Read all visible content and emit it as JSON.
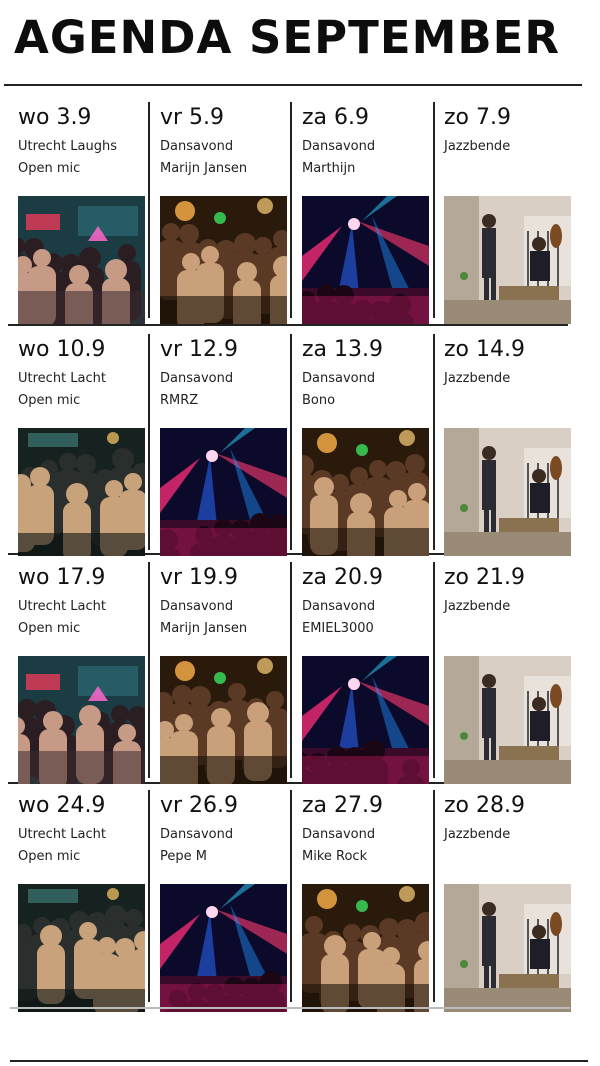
{
  "header": {
    "title": "AGENDA SEPTEMBER"
  },
  "weeks": [
    [
      {
        "day": "wo 3.9",
        "line1": "Utrecht Laughs",
        "line2": "Open mic",
        "photo": "comedy-audience"
      },
      {
        "day": "vr 5.9",
        "line1": "Dansavond",
        "line2": "Marijn Jansen",
        "photo": "dance-crowd"
      },
      {
        "day": "za 6.9",
        "line1": "Dansavond",
        "line2": "Marthijn",
        "photo": "club-lights"
      },
      {
        "day": "zo 7.9",
        "line1": "Jazzbende",
        "line2": "",
        "photo": "jazz-band"
      }
    ],
    [
      {
        "day": "wo 10.9",
        "line1": "Utrecht Lacht",
        "line2": "Open mic",
        "photo": "comedy-crowd"
      },
      {
        "day": "vr 12.9",
        "line1": "Dansavond",
        "line2": "RMRZ",
        "photo": "club-lights"
      },
      {
        "day": "za 13.9",
        "line1": "Dansavond",
        "line2": "Bono",
        "photo": "dance-crowd"
      },
      {
        "day": "zo 14.9",
        "line1": "Jazzbende",
        "line2": "",
        "photo": "jazz-band"
      }
    ],
    [
      {
        "day": "wo 17.9",
        "line1": "Utrecht Lacht",
        "line2": "Open mic",
        "photo": "comedy-audience"
      },
      {
        "day": "vr 19.9",
        "line1": "Dansavond",
        "line2": "Marijn Jansen",
        "photo": "dance-crowd"
      },
      {
        "day": "za 20.9",
        "line1": "Dansavond",
        "line2": "EMIEL3000",
        "photo": "club-lights"
      },
      {
        "day": "zo 21.9",
        "line1": "Jazzbende",
        "line2": "",
        "photo": "jazz-band"
      }
    ],
    [
      {
        "day": "wo 24.9",
        "line1": "Utrecht Lacht",
        "line2": "Open mic",
        "photo": "comedy-crowd"
      },
      {
        "day": "vr 26.9",
        "line1": "Dansavond",
        "line2": "Pepe M",
        "photo": "club-lights"
      },
      {
        "day": "za 27.9",
        "line1": "Dansavond",
        "line2": "Mike Rock",
        "photo": "dance-crowd"
      },
      {
        "day": "zo 28.9",
        "line1": "Jazzbende",
        "line2": "",
        "photo": "jazz-band"
      }
    ]
  ]
}
